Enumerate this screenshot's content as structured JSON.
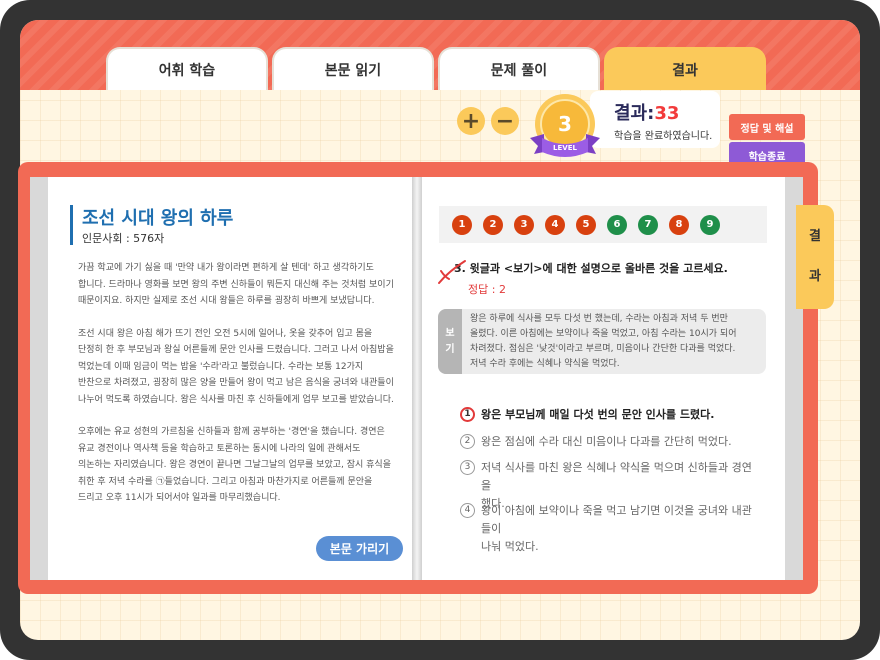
{
  "tabs": [
    {
      "label": "어휘 학습",
      "active": false
    },
    {
      "label": "본문 읽기",
      "active": false
    },
    {
      "label": "문제 풀이",
      "active": false
    },
    {
      "label": "결과",
      "active": true
    }
  ],
  "zoom": {
    "plus": "+",
    "minus": "−"
  },
  "level": {
    "number": "3",
    "label": "LEVEL"
  },
  "result": {
    "title": "결과:",
    "score": "33",
    "message": "학습을 완료하였습니다."
  },
  "side_buttons": {
    "answer_explain": "정답 및 해설",
    "finish": "학습종료"
  },
  "colors": {
    "accent_red": "#f26a55",
    "tab_yellow": "#fbc95a",
    "title_blue": "#1f6fb0",
    "purple": "#8e5ad6",
    "correct_green": "#1f8f4a",
    "wrong_red": "#d8410f"
  },
  "story": {
    "title": "조선 시대 왕의 하루",
    "category": "인문사회 : 576자",
    "paragraphs": [
      [
        "가끔 학교에 가기 싫을 때 '만약 내가 왕이라면 편하게 살 텐데' 하고 생각하기도",
        "합니다. 드라마나 영화를 보면 왕의 주변 신하들이 뭐든지 대신해 주는 것처럼 보이기",
        "때문이지요. 하지만 실제로 조선 시대 왕들은 하루를 굉장히 바쁘게 보냈답니다."
      ],
      [
        "조선 시대 왕은 아침 해가 뜨기 전인 오전 5시에 일어나, 옷을 갖추어 입고 몸을",
        "단정히 한 후 부모님과 왕실 어른들께 문안 인사를 드렸습니다. 그러고 나서 아침밥을",
        "먹었는데 이때 임금이 먹는 밥을 '수라'라고 불렀습니다. 수라는 보통 12가지",
        "반찬으로 차려졌고, 굉장히 많은 양을 만들어 왕이 먹고 남은 음식을 궁녀와 내관들이",
        "나누어 먹도록 하였습니다. 왕은 식사를 마친 후 신하들에게 업무 보고를 받았습니다."
      ],
      [
        "오후에는 유교 성현의 가르침을 신하들과 함께 공부하는 '경연'을 했습니다. 경연은",
        "유교 경전이나 역사책 등을 학습하고 토론하는 동시에 나라의 일에 관해서도",
        "의논하는 자리였습니다. 왕은 경연이 끝나면 그날그날의 업무를 보았고, 잠시 휴식을",
        "취한 후 저녁 수라를 ㉠들었습니다. 그리고 아침과 마찬가지로 어른들께 문안을",
        "드리고 오후 11시가 되어서야 일과를 마무리했습니다."
      ]
    ],
    "hide_button": "본문 가리기"
  },
  "question_nav": [
    {
      "num": "1",
      "status": "wrong"
    },
    {
      "num": "2",
      "status": "wrong"
    },
    {
      "num": "3",
      "status": "wrong"
    },
    {
      "num": "4",
      "status": "wrong"
    },
    {
      "num": "5",
      "status": "wrong"
    },
    {
      "num": "6",
      "status": "correct"
    },
    {
      "num": "7",
      "status": "correct"
    },
    {
      "num": "8",
      "status": "wrong"
    },
    {
      "num": "9",
      "status": "correct"
    }
  ],
  "question": {
    "text": "3. 윗글과 <보기>에 대한 설명으로 올바른 것을 고르세요.",
    "answer": "정답 : 2",
    "boki_label": [
      "보",
      "기"
    ],
    "boki_lines": [
      "왕은 하루에 식사를 모두 다섯 번 했는데, 수라는 아침과 저녁 두 번만",
      "올렸다. 이른 아침에는 보약이나 죽을 먹었고, 아침 수라는 10시가 되어",
      "차려졌다. 점심은 '낮것'이라고 부르며, 미음이나 간단한 다과를 먹었다.",
      "저녁 수라 후에는 식혜나 약식을 먹었다."
    ],
    "choices": [
      {
        "num": "1",
        "lines": [
          "왕은 부모님께 매일 다섯 번의 문안 인사를 드렸다."
        ],
        "selected": true
      },
      {
        "num": "2",
        "lines": [
          "왕은 점심에 수라 대신 미음이나 다과를 간단히 먹었다."
        ],
        "selected": false
      },
      {
        "num": "3",
        "lines": [
          "저녁 식사를 마친 왕은 식혜나 약식을 먹으며 신하들과 경연을",
          "했다."
        ],
        "selected": false
      },
      {
        "num": "4",
        "lines": [
          "왕이 아침에 보약이나 죽을 먹고 남기면 이것을 궁녀와 내관들이",
          "나눠 먹었다."
        ],
        "selected": false
      }
    ]
  },
  "result_side_tab": [
    "결",
    "과"
  ]
}
